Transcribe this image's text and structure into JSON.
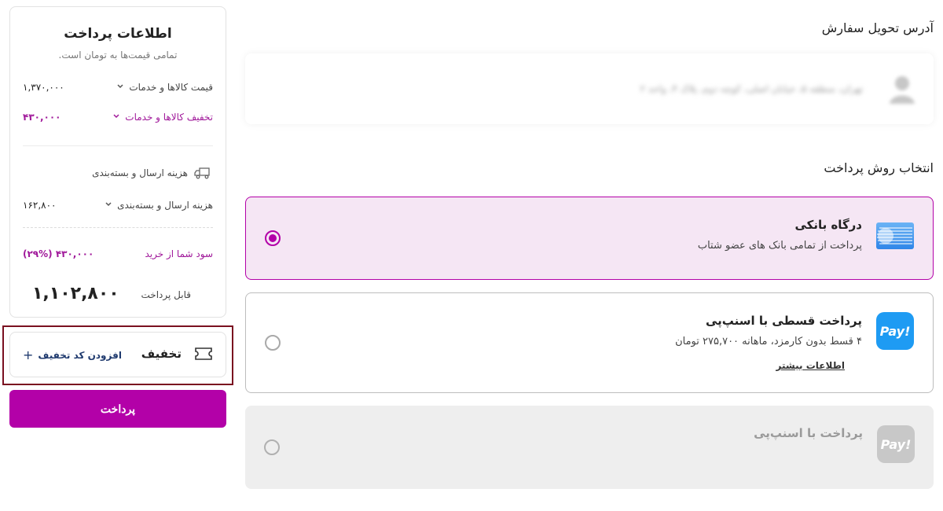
{
  "summary": {
    "title": "اطلاعات پرداخت",
    "subtitle": "تمامی قیمت‌ها به تومان است.",
    "goods_price_label": "قیمت کالاها و خدمات",
    "goods_price_value": "۱,۳۷۰,۰۰۰",
    "goods_discount_label": "تخفیف کالاها و خدمات",
    "goods_discount_value": "۴۳۰,۰۰۰",
    "shipping_header": "هزینه ارسال و بسته‌بندی",
    "shipping_label": "هزینه ارسال و بسته‌بندی",
    "shipping_value": "۱۶۲,۸۰۰",
    "profit_label": "سود شما از خرید",
    "profit_value": "۴۳۰,۰۰۰ (۲۹%)",
    "payable_label": "قابل پرداخت",
    "payable_value": "۱,۱۰۲,۸۰۰"
  },
  "discount": {
    "title": "تخفیف",
    "add_label": "افزودن کد تخفیف",
    "icon": "ticket-icon"
  },
  "pay_button": "پرداخت",
  "address": {
    "heading": "آدرس تحویل سفارش",
    "blurred_text": "تهران، منطقه ۵، خیابان اصلی، کوچه دوم، پلاک ۴، واحد ۲"
  },
  "payment": {
    "heading": "انتخاب روش پرداخت",
    "options": [
      {
        "title": "درگاه بانکی",
        "desc": "پرداخت از تمامی بانک های عضو شتاب",
        "selected": true,
        "icon": "bank-card-icon"
      },
      {
        "title": "پرداخت قسطی با اسنپ‌پی",
        "desc": "۴ قسط بدون کارمزد، ماهانه ۲۷۵,۷۰۰ تومان",
        "link": "اطلاعات بیشتر",
        "selected": false,
        "icon_text": "Pay!"
      },
      {
        "title": "پرداخت با اسنپ‌پی",
        "selected": false,
        "disabled": true,
        "icon_text": "Pay!"
      }
    ]
  },
  "colors": {
    "accent": "#b301a8",
    "selected_bg": "#f5e6f4",
    "snappay_blue": "#1e9bf3",
    "highlight_border": "#7a1020"
  }
}
